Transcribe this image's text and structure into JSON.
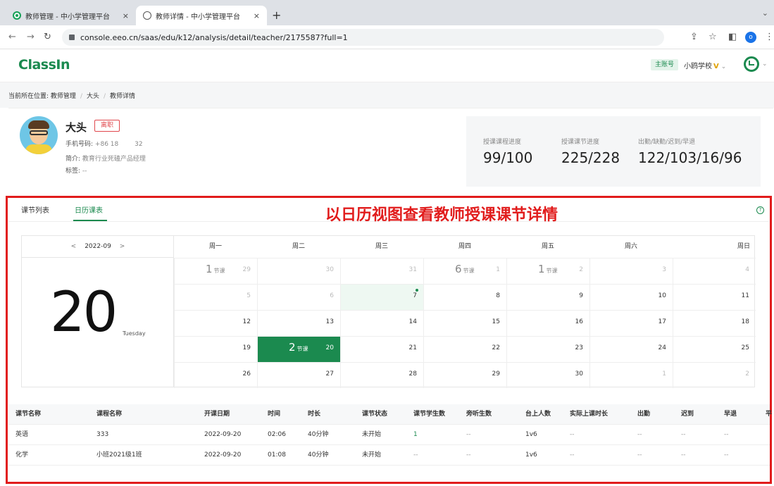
{
  "browser": {
    "tabs": [
      {
        "title": "教师管理 - 中小学管理平台",
        "close": "×"
      },
      {
        "title": "教师详情 - 中小学管理平台",
        "close": "×"
      }
    ],
    "new_tab": "+",
    "tab_menu": "⌄",
    "back": "←",
    "forward": "→",
    "reload": "↻",
    "url": "console.eeo.cn/saas/edu/k12/analysis/detail/teacher/2175587?full=1",
    "share_icon": "⇪",
    "star_icon": "☆",
    "split_icon": "◧",
    "profile_initial": "o",
    "menu_icon": "⋮"
  },
  "header": {
    "logo": "ClassIn",
    "account_badge": "主账号",
    "school": "小鸥学校",
    "vip_mark": "V",
    "chevron": "⌄"
  },
  "breadcrumb": {
    "prefix": "当前所在位置:",
    "items": [
      "教师管理",
      "大头",
      "教师详情"
    ],
    "sep": "/"
  },
  "teacher": {
    "name": "大头",
    "status": "离职",
    "phone_label": "手机号码:",
    "phone_value": "+86 18        32",
    "intro_label": "简介:",
    "intro_value": "教育行业死磕产品经理",
    "tags_label": "标签:",
    "tags_value": "--"
  },
  "stats": [
    {
      "label": "授课课程进度",
      "value": "99/100"
    },
    {
      "label": "授课课节进度",
      "value": "225/228"
    },
    {
      "label": "出勤/缺勤/迟到/早退",
      "value": "122/103/16/96"
    }
  ],
  "view_tabs": {
    "list": "课节列表",
    "calendar": "日历课表",
    "active": "calendar"
  },
  "headline": "以日历视图查看教师授课课节详情",
  "help": "?",
  "calendar": {
    "month": "2022-09",
    "prev": "<",
    "next": ">",
    "big_day": "20",
    "weekday": "Tuesday",
    "week_headers": [
      "周一",
      "周二",
      "周三",
      "周四",
      "周五",
      "周六",
      "周日"
    ],
    "lesson_unit": "节课",
    "rows": [
      [
        {
          "d": "29",
          "other": true,
          "n": "1"
        },
        {
          "d": "30",
          "other": true
        },
        {
          "d": "31",
          "other": true
        },
        {
          "d": "1",
          "other": true,
          "n": "6"
        },
        {
          "d": "2",
          "other": true,
          "n": "1"
        },
        {
          "d": "3",
          "other": true
        },
        {
          "d": "4",
          "other": true
        }
      ],
      [
        {
          "d": "5",
          "other": true
        },
        {
          "d": "6",
          "other": true
        },
        {
          "d": "7",
          "today": true
        },
        {
          "d": "8"
        },
        {
          "d": "9"
        },
        {
          "d": "10"
        },
        {
          "d": "11"
        }
      ],
      [
        {
          "d": "12"
        },
        {
          "d": "13"
        },
        {
          "d": "14"
        },
        {
          "d": "15"
        },
        {
          "d": "16"
        },
        {
          "d": "17"
        },
        {
          "d": "18"
        }
      ],
      [
        {
          "d": "19"
        },
        {
          "d": "20",
          "selected": true,
          "n": "2"
        },
        {
          "d": "21"
        },
        {
          "d": "22"
        },
        {
          "d": "23"
        },
        {
          "d": "24"
        },
        {
          "d": "25"
        }
      ],
      [
        {
          "d": "26"
        },
        {
          "d": "27"
        },
        {
          "d": "28"
        },
        {
          "d": "29"
        },
        {
          "d": "30"
        },
        {
          "d": "1",
          "other": true
        },
        {
          "d": "2",
          "other": true
        }
      ]
    ]
  },
  "table": {
    "columns": [
      "课节名称",
      "课程名称",
      "开课日期",
      "时间",
      "时长",
      "课节状态",
      "课节学生数",
      "旁听生数",
      "台上人数",
      "实际上课时长",
      "出勤",
      "迟到",
      "早退",
      "平"
    ],
    "rows": [
      [
        "英语",
        "333",
        "2022-09-20",
        "02:06",
        "40分钟",
        "未开始",
        "1",
        "--",
        "1v6",
        "--",
        "--",
        "--",
        "--"
      ],
      [
        "化学",
        "小班2021级1班",
        "2022-09-20",
        "01:08",
        "40分钟",
        "未开始",
        "--",
        "--",
        "1v6",
        "--",
        "--",
        "--",
        "--"
      ]
    ]
  }
}
